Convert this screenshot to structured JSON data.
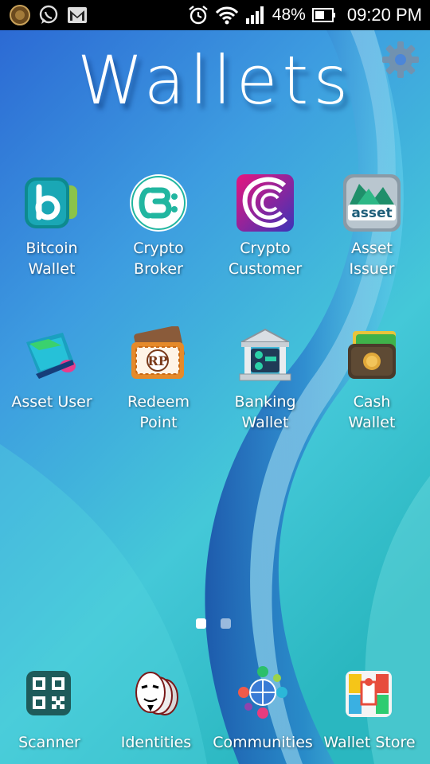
{
  "status_bar": {
    "battery_percent": "48%",
    "time": "09:20 PM",
    "icons": [
      "app-coin-icon",
      "whatsapp-icon",
      "gmail-icon",
      "alarm-icon",
      "wifi-icon",
      "signal-icon",
      "battery-icon"
    ]
  },
  "home": {
    "title": "Wallets",
    "settings_icon": "gear-icon",
    "apps": [
      {
        "label": "Bitcoin\nWallet",
        "icon": "bitcoin-wallet-icon"
      },
      {
        "label": "Crypto\nBroker",
        "icon": "crypto-broker-icon"
      },
      {
        "label": "Crypto\nCustomer",
        "icon": "crypto-customer-icon"
      },
      {
        "label": "Asset\nIssuer",
        "icon": "asset-issuer-icon"
      },
      {
        "label": "Asset User",
        "icon": "asset-user-icon"
      },
      {
        "label": "Redeem\nPoint",
        "icon": "redeem-point-icon"
      },
      {
        "label": "Banking\nWallet",
        "icon": "banking-wallet-icon"
      },
      {
        "label": "Cash\nWallet",
        "icon": "cash-wallet-icon"
      }
    ],
    "page_indicator": {
      "pages": 2,
      "current": 1
    }
  },
  "dock": [
    {
      "label": "Scanner",
      "icon": "qr-scanner-icon"
    },
    {
      "label": "Identities",
      "icon": "identities-mask-icon"
    },
    {
      "label": "Communities",
      "icon": "communities-globe-icon"
    },
    {
      "label": "Wallet Store",
      "icon": "wallet-store-icon"
    }
  ],
  "colors": {
    "status_bar_bg": "#000000",
    "wallpaper_top": "#2f73d6",
    "wallpaper_bottom": "#3fd0d0",
    "text": "#ffffff"
  }
}
